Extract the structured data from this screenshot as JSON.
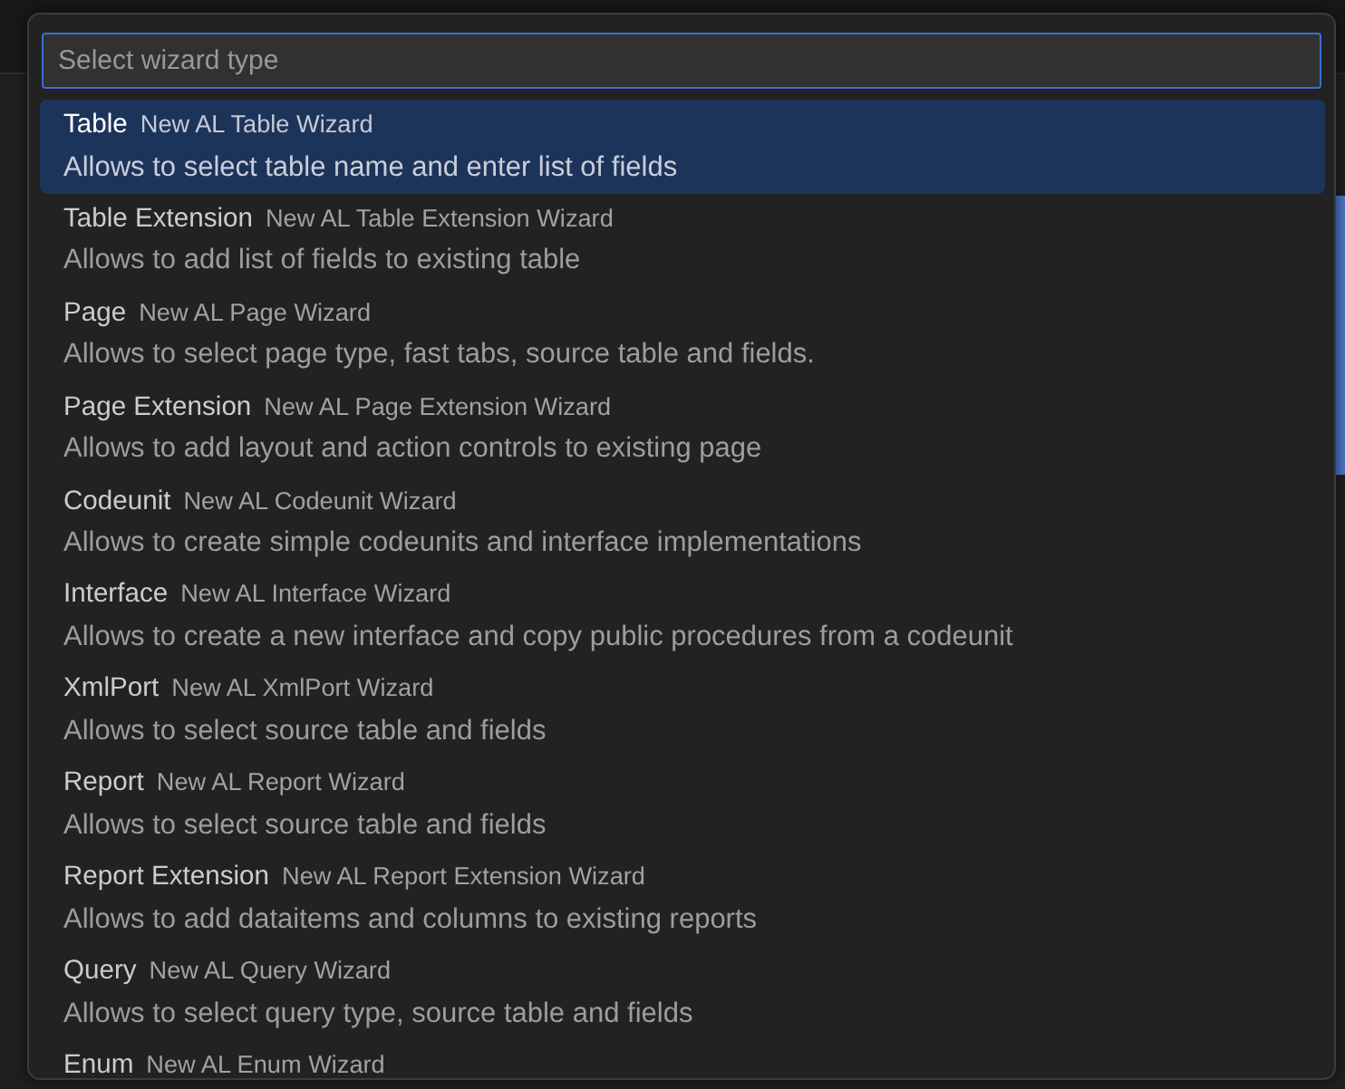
{
  "input": {
    "placeholder": "Select wizard type"
  },
  "items": [
    {
      "label": "Table",
      "detail": "New AL Table Wizard",
      "description": "Allows to select table name and enter list of fields",
      "selected": true
    },
    {
      "label": "Table Extension",
      "detail": "New AL Table Extension Wizard",
      "description": "Allows to add list of fields to existing table",
      "selected": false
    },
    {
      "label": "Page",
      "detail": "New AL Page Wizard",
      "description": "Allows to select page type, fast tabs, source table and fields.",
      "selected": false
    },
    {
      "label": "Page Extension",
      "detail": "New AL Page Extension Wizard",
      "description": "Allows to add layout and action controls to existing page",
      "selected": false
    },
    {
      "label": "Codeunit",
      "detail": "New AL Codeunit Wizard",
      "description": "Allows to create simple codeunits and interface implementations",
      "selected": false
    },
    {
      "label": "Interface",
      "detail": "New AL Interface Wizard",
      "description": "Allows to create a new interface and copy public procedures from a codeunit",
      "selected": false
    },
    {
      "label": "XmlPort",
      "detail": "New AL XmlPort Wizard",
      "description": "Allows to select source table and fields",
      "selected": false
    },
    {
      "label": "Report",
      "detail": "New AL Report Wizard",
      "description": "Allows to select source table and fields",
      "selected": false
    },
    {
      "label": "Report Extension",
      "detail": "New AL Report Extension Wizard",
      "description": "Allows to add dataitems and columns to existing reports",
      "selected": false
    },
    {
      "label": "Query",
      "detail": "New AL Query Wizard",
      "description": "Allows to select query type, source table and fields",
      "selected": false
    },
    {
      "label": "Enum",
      "detail": "New AL Enum Wizard",
      "selected": false
    }
  ]
}
